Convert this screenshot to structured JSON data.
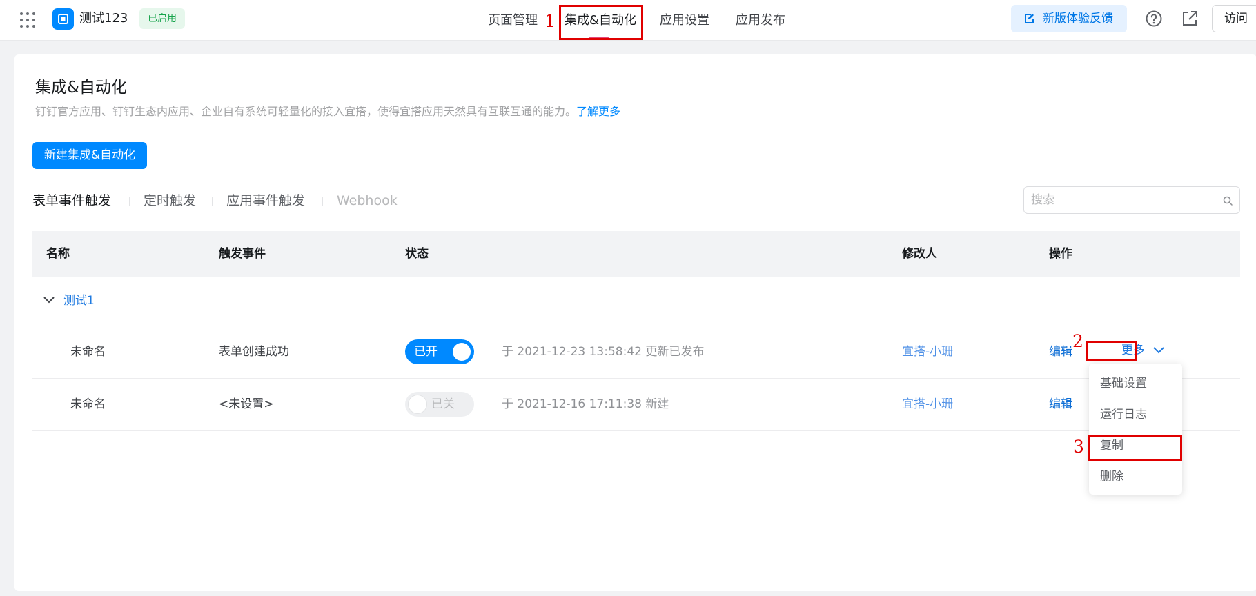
{
  "header": {
    "app_name": "测试123",
    "status_tag": "已启用",
    "tabs": [
      {
        "label": "页面管理",
        "active": false
      },
      {
        "label": "集成&自动化",
        "active": true
      },
      {
        "label": "应用设置",
        "active": false
      },
      {
        "label": "应用发布",
        "active": false
      }
    ],
    "feedback_button": "新版体验反馈",
    "visit_button": "访问"
  },
  "page": {
    "title": "集成&自动化",
    "description": "钉钉官方应用、钉钉生态内应用、企业自有系统可轻量化的接入宜搭，使得宜搭应用天然具有互联互通的能力。",
    "learn_more": "了解更多",
    "create_button": "新建集成&自动化"
  },
  "subtabs": [
    {
      "label": "表单事件触发",
      "state": "active"
    },
    {
      "label": "定时触发",
      "state": "normal"
    },
    {
      "label": "应用事件触发",
      "state": "normal"
    },
    {
      "label": "Webhook",
      "state": "disabled"
    }
  ],
  "search": {
    "placeholder": "搜索"
  },
  "table": {
    "columns": [
      "名称",
      "触发事件",
      "状态",
      "修改人",
      "操作"
    ],
    "group": {
      "name": "测试1",
      "expanded": true
    },
    "rows": [
      {
        "name": "未命名",
        "trigger": "表单创建成功",
        "switch_on": true,
        "switch_label": "已开",
        "status_text": "于 2021-12-23 13:58:42 更新已发布",
        "modifier": "宜搭-小珊",
        "edit": "编辑",
        "more": "更多"
      },
      {
        "name": "未命名",
        "trigger": "<未设置>",
        "switch_on": false,
        "switch_label": "已关",
        "status_text": "于 2021-12-16 17:11:38 新建",
        "modifier": "宜搭-小珊",
        "edit": "编辑"
      }
    ]
  },
  "more_menu": {
    "items": [
      "基础设置",
      "运行日志",
      "复制",
      "删除"
    ]
  },
  "annotations": [
    "1",
    "2",
    "3"
  ],
  "colors": {
    "primary": "#0089ff",
    "annotation": "#e00000",
    "enabled_tag_bg": "#e6f7ec",
    "enabled_tag_text": "#15a34a"
  },
  "icons": [
    "app-grid-icon",
    "app-logo-icon",
    "edit-feedback-icon",
    "help-circle-icon",
    "external-link-icon",
    "search-icon",
    "chevron-down-icon"
  ]
}
